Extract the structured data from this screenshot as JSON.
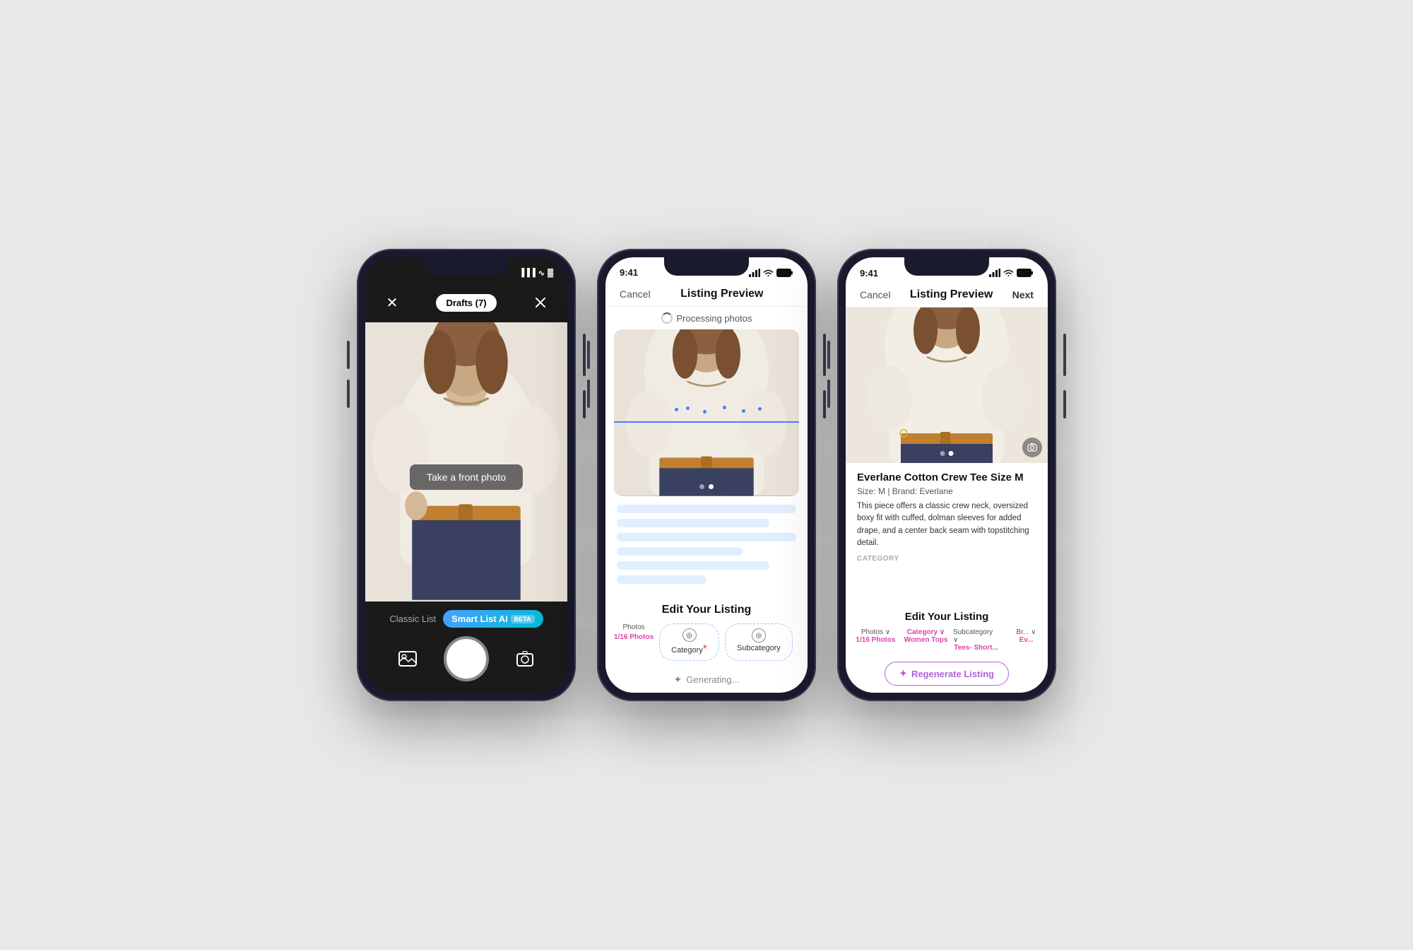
{
  "phone1": {
    "topbar": {
      "close_label": "×",
      "drafts_label": "Drafts (7)",
      "edit_label": "✕"
    },
    "camera": {
      "take_photo_prompt": "Take a front photo",
      "mode_classic": "Classic List",
      "mode_smart": "Smart List AI",
      "beta": "BETA"
    }
  },
  "phone2": {
    "status_time": "9:41",
    "topbar": {
      "cancel": "Cancel",
      "title": "Listing Preview",
      "next": ""
    },
    "processing": "Processing photos",
    "edit_section": "Edit Your Listing",
    "tabs": [
      {
        "top": "Photos",
        "bottom": "1/16 Photos",
        "label": ""
      },
      {
        "top": "",
        "bottom": "",
        "label": "Category",
        "required": true
      },
      {
        "top": "",
        "bottom": "",
        "label": "Subcategory"
      }
    ],
    "generating": "Generating..."
  },
  "phone3": {
    "status_time": "9:41",
    "topbar": {
      "cancel": "Cancel",
      "title": "Listing Preview",
      "next": "Next"
    },
    "listing": {
      "title": "Everlane Cotton Crew Tee Size M",
      "subtitle": "Size: M  |  Brand: Everlane",
      "description": "This piece offers a classic crew neck, oversized boxy fit with cuffed, dolman sleeves for added drape, and a center back seam with topstitching detail.",
      "category_label": "CATEGORY"
    },
    "edit_section": "Edit Your Listing",
    "tabs": [
      {
        "top": "Photos",
        "value": "1/16 Photos"
      },
      {
        "top": "Category",
        "value": "Women Tops"
      },
      {
        "top": "Subcategory",
        "value": "Tees- Short..."
      },
      {
        "top": "Br...",
        "value": "Ev..."
      }
    ],
    "regen_btn": "✦ Regenerate Listing"
  }
}
